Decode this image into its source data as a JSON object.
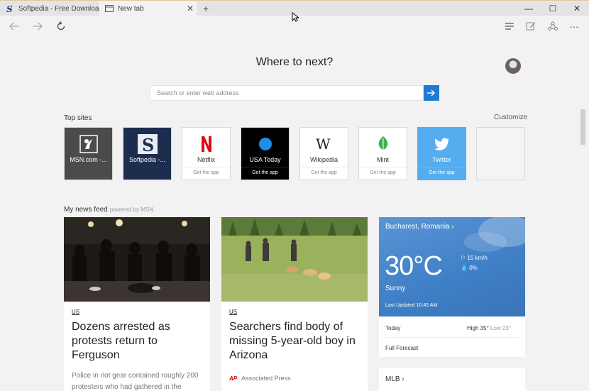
{
  "browser": {
    "tabs": [
      {
        "title": "Softpedia - Free Downloads",
        "icon": "softpedia-logo-icon"
      },
      {
        "title": "New tab",
        "icon": "tab-page-icon",
        "close": "✕"
      }
    ],
    "new_tab_symbol": "+",
    "window_controls": {
      "minimize": "—",
      "maximize": "☐",
      "close": "✕"
    },
    "more_symbol": "···"
  },
  "page": {
    "heading": "Where to next?",
    "search": {
      "placeholder": "Search or enter web address"
    },
    "top_sites_label": "Top sites",
    "customize_label": "Customize",
    "top_sites": [
      {
        "name": "MSN.com -...",
        "sub": ""
      },
      {
        "name": "Softpedia -...",
        "sub": ""
      },
      {
        "name": "Netflix",
        "sub": "Get the app"
      },
      {
        "name": "USA Today",
        "sub": "Get the app"
      },
      {
        "name": "Wikipedia",
        "sub": "Get the app"
      },
      {
        "name": "Mint",
        "sub": "Get the app"
      },
      {
        "name": "Twitter",
        "sub": "Get the app"
      }
    ],
    "feed_label": "My news feed",
    "feed_powered": "powered by MSN",
    "cards": [
      {
        "tag": "US",
        "title": "Dozens arrested as protests return to Ferguson",
        "snippet": "Police in riot gear contained roughly 200 protesters who had gathered in the"
      },
      {
        "tag": "US",
        "title": "Searchers find body of missing 5-year-old boy in Arizona",
        "source_logo": "AP",
        "source": "Associated Press"
      }
    ],
    "weather": {
      "city": "Bucharest, Romania",
      "temperature": "30°C",
      "wind": "15 km/h",
      "precip": "0%",
      "condition": "Sunny",
      "updated": "Last Updated 10:45 AM",
      "today_label": "Today",
      "high": "High 35°",
      "low": "Low 23°",
      "forecast_label": "Full Forecast"
    },
    "mlb_label": "MLB"
  },
  "colors": {
    "accent": "#1f7ad6",
    "msn_tile": "#4b4b4b",
    "softpedia_tile": "#1c2d4e",
    "usatoday_tile": "#000000",
    "twitter_tile": "#55acee",
    "netflix_red": "#e50914",
    "mint_green": "#3bb54a"
  }
}
